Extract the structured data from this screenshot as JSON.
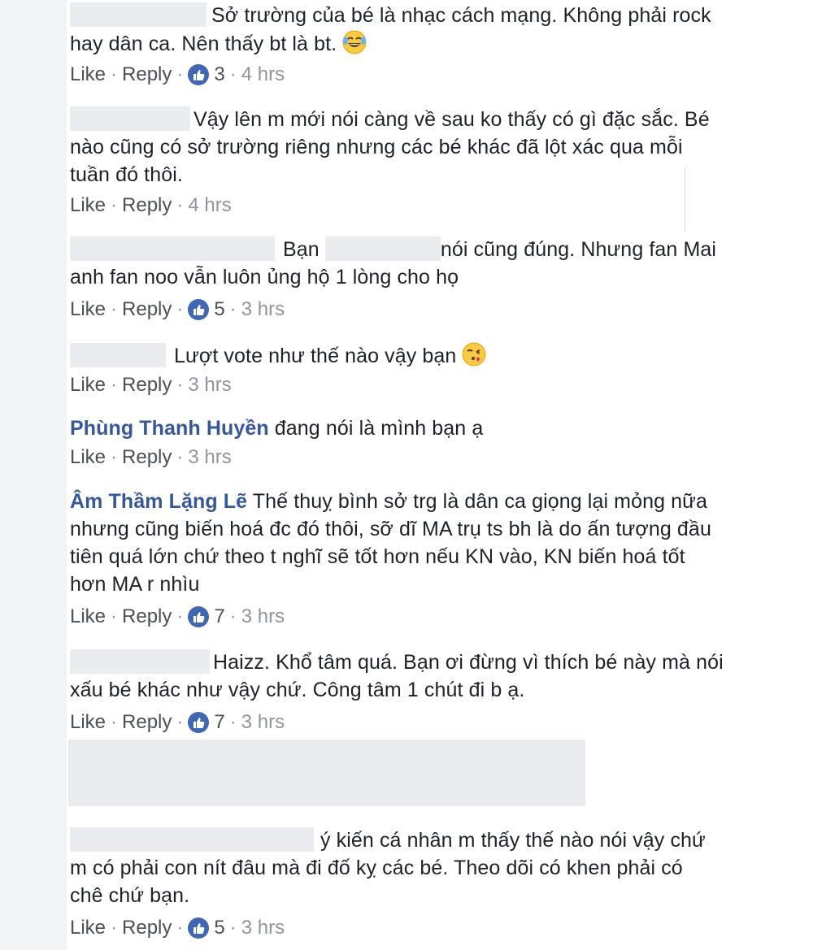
{
  "actions": {
    "like": "Like",
    "reply": "Reply",
    "sep": "·"
  },
  "comments": [
    {
      "lines": [
        "Sở trường của bé là nhạc cách mạng. Không phải rock",
        "hay dân ca. Nên thấy bt là bt."
      ],
      "likes": "3",
      "time": "4 hrs",
      "emoji": "laughing-tears"
    },
    {
      "lines": [
        "Vậy lên m mới nói càng về sau ko thấy có gì đặc sắc. Bé",
        "nào cũng có sở trường riêng nhưng các bé khác đã lột xác qua mỗi",
        "tuần đó thôi."
      ],
      "likes": "",
      "time": "4 hrs"
    },
    {
      "lines": [
        "Bạn",
        "nói cũng đúng. Nhưng fan Mai",
        "anh fan noo vẫn luôn ủng hộ 1 lòng cho họ"
      ],
      "likes": "5",
      "time": "3 hrs"
    },
    {
      "lines": [
        "Lượt vote như thế nào vậy bạn"
      ],
      "likes": "",
      "time": "3 hrs",
      "emoji": "kissing-heart"
    },
    {
      "name": "Phùng Thanh Huyền",
      "lines": [
        "đang nói là mình bạn ạ"
      ],
      "likes": "",
      "time": "3 hrs"
    },
    {
      "name": "Âm Thầm Lặng Lẽ",
      "lines": [
        "Thế thuỵ bình sở trg là dân ca giọng lại mỏng nữa",
        "nhưng cũng biến hoá đc đó thôi, sỡ dĩ MA trụ ts bh là do ấn tượng đầu",
        "tiên quá lớn chứ theo t nghĩ sẽ tốt hơn nếu KN vào, KN biến hoá tốt",
        "hơn MA r nhìu"
      ],
      "likes": "7",
      "time": "3 hrs"
    },
    {
      "lines": [
        "Haizz. Khổ tâm quá. Bạn ơi đừng vì thích bé này mà nói",
        "xấu bé khác như vậy chứ. Công tâm 1 chút đi b ạ."
      ],
      "likes": "7",
      "time": "3 hrs"
    },
    {
      "lines": [
        "ý kiến cá nhân m thấy thế nào nói vậy chứ",
        "m có phải con nít đâu mà đi đố kỵ các bé. Theo dõi có khen phải có",
        "chê chứ bạn."
      ],
      "likes": "5",
      "time": "3 hrs"
    }
  ]
}
